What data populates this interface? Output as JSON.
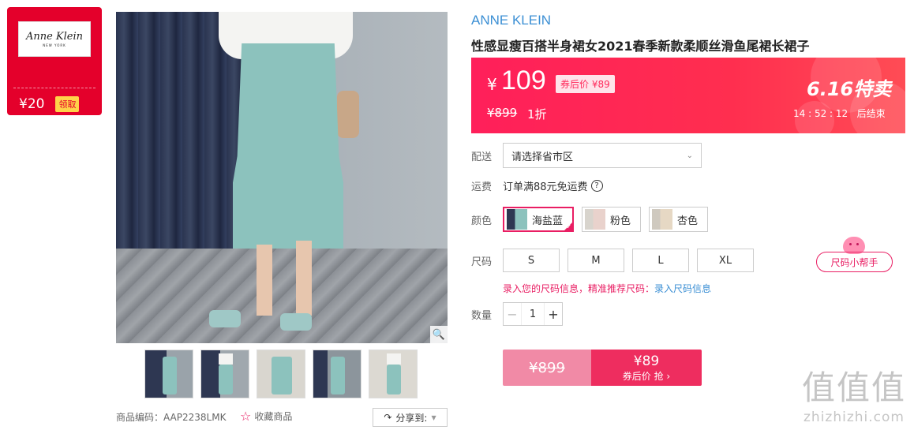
{
  "store": {
    "logo_text": "Anne Klein",
    "logo_sub": "NEW YORK",
    "coupon_amount": "¥20",
    "coupon_claim": "领取"
  },
  "gallery": {
    "thumbnail_count": 5
  },
  "product": {
    "sku_label": "商品编码：AAP2238LMK",
    "favorite_label": "收藏商品",
    "share_label": "分享到:",
    "brand": "ANNE KLEIN",
    "title": "性感显瘦百搭半身裙女2021春季新款柔顺丝滑鱼尾裙长裙子"
  },
  "price": {
    "currency": "¥",
    "current": "109",
    "after_coupon": "券后价 ¥89",
    "original": "¥899",
    "discount": "1折",
    "promo": "6.16特卖",
    "countdown": "14 : 52 : 12",
    "countdown_suffix": "后结束"
  },
  "delivery": {
    "label": "配送",
    "value": "请选择省市区"
  },
  "shipping": {
    "label": "运费",
    "value": "订单满88元免运费"
  },
  "color": {
    "label": "颜色",
    "options": [
      {
        "name": "海盐蓝",
        "selected": true,
        "swatch": "#8cc2bd"
      },
      {
        "name": "粉色",
        "selected": false,
        "swatch": "#e9d2cc"
      },
      {
        "name": "杏色",
        "selected": false,
        "swatch": "#e6d8c4"
      }
    ]
  },
  "size": {
    "label": "尺码",
    "options": [
      "S",
      "M",
      "L",
      "XL"
    ],
    "helper_button": "尺码小帮手",
    "hint_text": "录入您的尺码信息，精准推荐尺码：",
    "hint_link": "录入尺码信息"
  },
  "quantity": {
    "label": "数量",
    "value": "1",
    "minus": "−",
    "plus": "+"
  },
  "buy": {
    "original": "¥899",
    "price": "¥89",
    "cta": "券后价 抢 ›"
  },
  "watermark": {
    "glyphs": "值值值",
    "domain": "zhizhizhi.com"
  },
  "colors": {
    "accent_pink": "#e91e63",
    "price_red": "#ff1f5a",
    "brand_blue": "#3b8fd4"
  }
}
